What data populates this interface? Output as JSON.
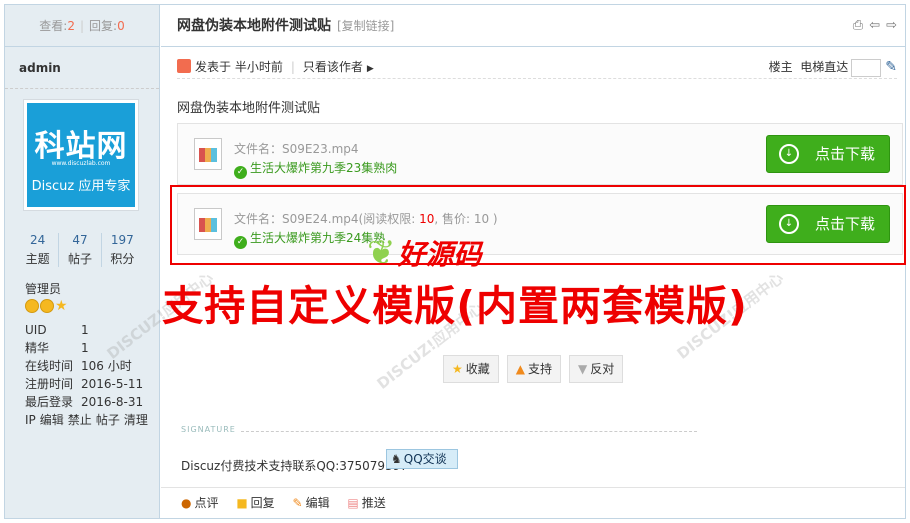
{
  "stats": {
    "views_label": "查看:",
    "views": "2",
    "replies_label": "回复:",
    "replies": "0"
  },
  "thread": {
    "title": "网盘伪装本地附件测试贴",
    "copy_link": "[复制链接]"
  },
  "author": {
    "name": "admin",
    "avatar": {
      "big": "科站网",
      "url": "www.discuzlab.com",
      "brand": "Discuz 应用专家"
    },
    "counts": [
      {
        "num": "24",
        "label": "主题"
      },
      {
        "num": "47",
        "label": "帖子"
      },
      {
        "num": "197",
        "label": "积分"
      }
    ],
    "role": "管理员",
    "info": [
      {
        "k": "UID",
        "v": "1"
      },
      {
        "k": "精华",
        "v": "1"
      },
      {
        "k": "在线时间",
        "v": "106 小时"
      },
      {
        "k": "注册时间",
        "v": "2016-5-11"
      },
      {
        "k": "最后登录",
        "v": "2016-8-31"
      }
    ],
    "admin_links": [
      "IP",
      "编辑",
      "禁止",
      "帖子",
      "清理"
    ]
  },
  "meta": {
    "posted": "发表于 半小时前",
    "only_author": "只看该作者",
    "floor_label": "楼主",
    "jump_label": "电梯直达"
  },
  "post": {
    "text": "网盘伪装本地附件测试贴"
  },
  "attachments": [
    {
      "name_prefix": "文件名：",
      "name": "S09E23.mp4",
      "desc": "生活大爆炸第九季23集熟肉",
      "button": "点击下载"
    },
    {
      "name_prefix": "文件名：",
      "name": "S09E24.mp4(阅读权限: ",
      "perm": "10",
      "price": ", 售价: 10 )",
      "desc": "生活大爆炸第九季24集熟",
      "button": "点击下载"
    }
  ],
  "overlay": {
    "logo_text": "好源码",
    "banner": "支持自定义模版(内置两套模版)"
  },
  "actions": [
    {
      "icon": "★",
      "label": "收藏"
    },
    {
      "icon": "▲",
      "label": "支持"
    },
    {
      "icon": "▼",
      "label": "反对"
    }
  ],
  "signature": {
    "label": "SIGNATURE",
    "text": "Discuz付费技术支持联系QQ:375079397",
    "qq_button": "QQ交谈"
  },
  "bottom": [
    {
      "label": "点评"
    },
    {
      "label": "回复"
    },
    {
      "label": "编辑"
    },
    {
      "label": "推送"
    }
  ]
}
